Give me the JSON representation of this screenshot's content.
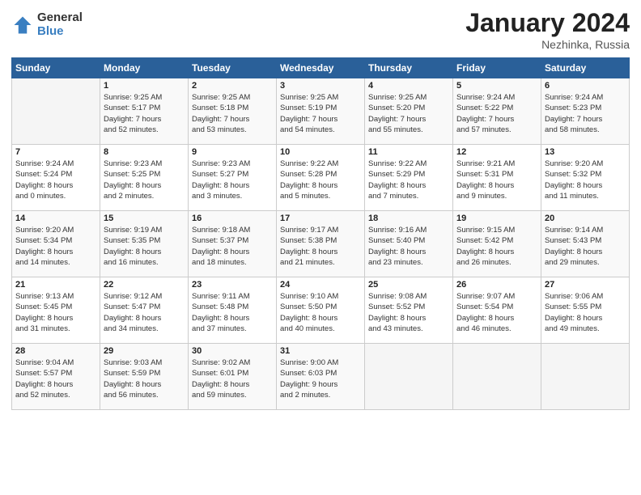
{
  "logo": {
    "general": "General",
    "blue": "Blue"
  },
  "title": "January 2024",
  "subtitle": "Nezhinka, Russia",
  "days_of_week": [
    "Sunday",
    "Monday",
    "Tuesday",
    "Wednesday",
    "Thursday",
    "Friday",
    "Saturday"
  ],
  "weeks": [
    [
      {
        "day": "",
        "info": ""
      },
      {
        "day": "1",
        "info": "Sunrise: 9:25 AM\nSunset: 5:17 PM\nDaylight: 7 hours\nand 52 minutes."
      },
      {
        "day": "2",
        "info": "Sunrise: 9:25 AM\nSunset: 5:18 PM\nDaylight: 7 hours\nand 53 minutes."
      },
      {
        "day": "3",
        "info": "Sunrise: 9:25 AM\nSunset: 5:19 PM\nDaylight: 7 hours\nand 54 minutes."
      },
      {
        "day": "4",
        "info": "Sunrise: 9:25 AM\nSunset: 5:20 PM\nDaylight: 7 hours\nand 55 minutes."
      },
      {
        "day": "5",
        "info": "Sunrise: 9:24 AM\nSunset: 5:22 PM\nDaylight: 7 hours\nand 57 minutes."
      },
      {
        "day": "6",
        "info": "Sunrise: 9:24 AM\nSunset: 5:23 PM\nDaylight: 7 hours\nand 58 minutes."
      }
    ],
    [
      {
        "day": "7",
        "info": "Sunrise: 9:24 AM\nSunset: 5:24 PM\nDaylight: 8 hours\nand 0 minutes."
      },
      {
        "day": "8",
        "info": "Sunrise: 9:23 AM\nSunset: 5:25 PM\nDaylight: 8 hours\nand 2 minutes."
      },
      {
        "day": "9",
        "info": "Sunrise: 9:23 AM\nSunset: 5:27 PM\nDaylight: 8 hours\nand 3 minutes."
      },
      {
        "day": "10",
        "info": "Sunrise: 9:22 AM\nSunset: 5:28 PM\nDaylight: 8 hours\nand 5 minutes."
      },
      {
        "day": "11",
        "info": "Sunrise: 9:22 AM\nSunset: 5:29 PM\nDaylight: 8 hours\nand 7 minutes."
      },
      {
        "day": "12",
        "info": "Sunrise: 9:21 AM\nSunset: 5:31 PM\nDaylight: 8 hours\nand 9 minutes."
      },
      {
        "day": "13",
        "info": "Sunrise: 9:20 AM\nSunset: 5:32 PM\nDaylight: 8 hours\nand 11 minutes."
      }
    ],
    [
      {
        "day": "14",
        "info": "Sunrise: 9:20 AM\nSunset: 5:34 PM\nDaylight: 8 hours\nand 14 minutes."
      },
      {
        "day": "15",
        "info": "Sunrise: 9:19 AM\nSunset: 5:35 PM\nDaylight: 8 hours\nand 16 minutes."
      },
      {
        "day": "16",
        "info": "Sunrise: 9:18 AM\nSunset: 5:37 PM\nDaylight: 8 hours\nand 18 minutes."
      },
      {
        "day": "17",
        "info": "Sunrise: 9:17 AM\nSunset: 5:38 PM\nDaylight: 8 hours\nand 21 minutes."
      },
      {
        "day": "18",
        "info": "Sunrise: 9:16 AM\nSunset: 5:40 PM\nDaylight: 8 hours\nand 23 minutes."
      },
      {
        "day": "19",
        "info": "Sunrise: 9:15 AM\nSunset: 5:42 PM\nDaylight: 8 hours\nand 26 minutes."
      },
      {
        "day": "20",
        "info": "Sunrise: 9:14 AM\nSunset: 5:43 PM\nDaylight: 8 hours\nand 29 minutes."
      }
    ],
    [
      {
        "day": "21",
        "info": "Sunrise: 9:13 AM\nSunset: 5:45 PM\nDaylight: 8 hours\nand 31 minutes."
      },
      {
        "day": "22",
        "info": "Sunrise: 9:12 AM\nSunset: 5:47 PM\nDaylight: 8 hours\nand 34 minutes."
      },
      {
        "day": "23",
        "info": "Sunrise: 9:11 AM\nSunset: 5:48 PM\nDaylight: 8 hours\nand 37 minutes."
      },
      {
        "day": "24",
        "info": "Sunrise: 9:10 AM\nSunset: 5:50 PM\nDaylight: 8 hours\nand 40 minutes."
      },
      {
        "day": "25",
        "info": "Sunrise: 9:08 AM\nSunset: 5:52 PM\nDaylight: 8 hours\nand 43 minutes."
      },
      {
        "day": "26",
        "info": "Sunrise: 9:07 AM\nSunset: 5:54 PM\nDaylight: 8 hours\nand 46 minutes."
      },
      {
        "day": "27",
        "info": "Sunrise: 9:06 AM\nSunset: 5:55 PM\nDaylight: 8 hours\nand 49 minutes."
      }
    ],
    [
      {
        "day": "28",
        "info": "Sunrise: 9:04 AM\nSunset: 5:57 PM\nDaylight: 8 hours\nand 52 minutes."
      },
      {
        "day": "29",
        "info": "Sunrise: 9:03 AM\nSunset: 5:59 PM\nDaylight: 8 hours\nand 56 minutes."
      },
      {
        "day": "30",
        "info": "Sunrise: 9:02 AM\nSunset: 6:01 PM\nDaylight: 8 hours\nand 59 minutes."
      },
      {
        "day": "31",
        "info": "Sunrise: 9:00 AM\nSunset: 6:03 PM\nDaylight: 9 hours\nand 2 minutes."
      },
      {
        "day": "",
        "info": ""
      },
      {
        "day": "",
        "info": ""
      },
      {
        "day": "",
        "info": ""
      }
    ]
  ]
}
